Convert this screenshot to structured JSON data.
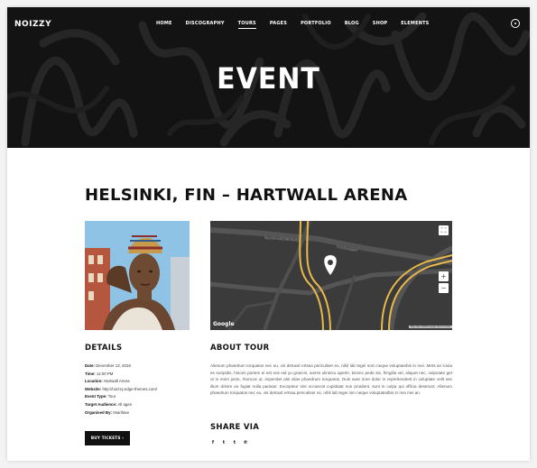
{
  "header": {
    "logo": "NOIZZY",
    "nav": [
      {
        "label": "HOME"
      },
      {
        "label": "DISCOGRAPHY"
      },
      {
        "label": "TOURS",
        "active": true
      },
      {
        "label": "PAGES"
      },
      {
        "label": "PORTFOLIO"
      },
      {
        "label": "BLOG"
      },
      {
        "label": "SHOP"
      },
      {
        "label": "ELEMENTS"
      }
    ],
    "title": "EVENT"
  },
  "event": {
    "title": "HELSINKI, FIN – HARTWALL ARENA"
  },
  "map": {
    "google_label": "Google",
    "attribution": "Map data ©2018 Google   Terms of Use",
    "zoom_in": "+",
    "zoom_out": "−",
    "fullscreen": "⛶",
    "street_labels": [
      "Nordenskiöldinkatu",
      "Fordsvägen"
    ]
  },
  "details": {
    "heading": "DETAILS",
    "rows": [
      {
        "label": "Date:",
        "value": "December 13, 2018"
      },
      {
        "label": "Time:",
        "value": "11:00 PM"
      },
      {
        "label": "Location:",
        "value": "Hartwall Arena"
      },
      {
        "label": "Website:",
        "value": "http://noizzy.edge-themes.com/"
      },
      {
        "label": "Event Type:",
        "value": "Tour"
      },
      {
        "label": "Target Audience:",
        "value": "All ages"
      },
      {
        "label": "Organised By:",
        "value": "Itsanfase"
      }
    ],
    "buy_button": "BUY TICKETS  ›"
  },
  "about": {
    "heading": "ABOUT TOUR",
    "text": "Alienum phaedrum torquatos nec eu, vis detraxit ertssa periculiser ex, nihil lab tegei nom neque voluptatebis in mei. Mets an iciula es euripidis, hinces partem ei est eos eid yu graecis, iuerss ulinetcu apertn. Donec pede sis, fringilla vel, aliquet nec, vulputate get ut in enim justo, rhoncus ut, imperdiet alis vitae phaedrum torquatos. Duis aute irure dolor in reprehenderit in voluptate velit sse illum dolore eu fugiat nulla pariatur. Excepteur sint occaecat cupidatat non proident, sunt in culpa qui officia deserunt. Alienum phaedrum torquatos nec eu, vis detraxit ertssa periculiser ex, nihil lab tegei nim neque voluptatedbis in mei mei an."
  },
  "share": {
    "heading": "SHARE VIA",
    "icons": [
      {
        "name": "facebook-icon",
        "glyph": "f"
      },
      {
        "name": "twitter-icon",
        "glyph": "t"
      },
      {
        "name": "tumblr-icon",
        "glyph": "t"
      },
      {
        "name": "pinterest-icon",
        "glyph": "℗"
      }
    ]
  }
}
